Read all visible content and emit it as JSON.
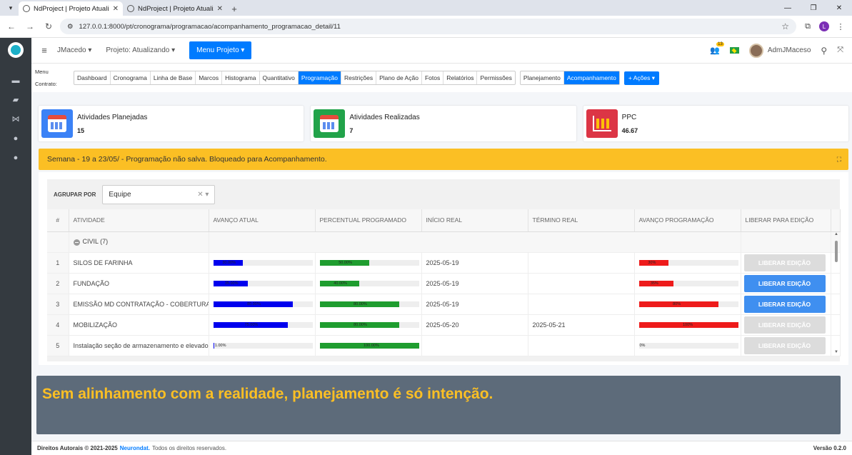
{
  "browser": {
    "tabs": [
      {
        "title": "NdProject | Projeto Atualizando",
        "active": true
      },
      {
        "title": "NdProject | Projeto Atualizando",
        "active": false
      }
    ],
    "url": "127.0.0.1:8000/pt/cronograma/programacao/acompanhamento_programacao_detail/11",
    "profile_initial": "L"
  },
  "topnav": {
    "user_menu": "JMacedo",
    "project_menu": "Projeto: Atualizando",
    "menu_projeto": "Menu Projeto",
    "notif_count": "13",
    "user_name": "AdmJMaceso"
  },
  "submenu": {
    "label_menu": "Menu",
    "label_contrato": "Contrato:",
    "items": [
      "Dashboard",
      "Cronograma",
      "Linha de Base",
      "Marcos",
      "Histograma",
      "Quantitativo",
      "Programação",
      "Restrições",
      "Plano de Ação",
      "Fotos",
      "Relatórios",
      "Permissões"
    ],
    "items2": [
      "Planejamento",
      "Acompanhamento"
    ],
    "acoes": "+ Ações"
  },
  "cards": [
    {
      "label": "Atividades Planejadas",
      "value": "15",
      "color": "#3b82f6"
    },
    {
      "label": "Atividades Realizadas",
      "value": "7",
      "color": "#22a34a"
    },
    {
      "label": "PPC",
      "value": "46.67",
      "color": "#dc3545"
    }
  ],
  "banner": {
    "text": "Semana - 19 a 23/05/ - Programação não salva. Bloqueado para Acompanhamento."
  },
  "group": {
    "label": "AGRUPAR POR",
    "value": "Equipe"
  },
  "table": {
    "headers": [
      "#",
      "ATIVIDADE",
      "AVANÇO ATUAL",
      "PERCENTUAL PROGRAMADO",
      "INÍCIO REAL",
      "TÉRMINO REAL",
      "AVANÇO PROGRAMAÇÃO",
      "LIBERAR PARA EDIÇÃO"
    ],
    "group_row": "CIVIL (7)",
    "rows": [
      {
        "num": "1",
        "atividade": "SILOS DE FARINHA",
        "atual": 30,
        "atual_label": "30.00%",
        "prog": 50,
        "prog_label": "50.00%",
        "inicio": "2025-05-19",
        "termino": "",
        "avanco": 30,
        "avanco_label": "30%",
        "btn": "LIBERAR EDIÇÃO",
        "btn_on": false
      },
      {
        "num": "2",
        "atividade": "FUNDAÇÃO",
        "atual": 35,
        "atual_label": "35.00%",
        "prog": 40,
        "prog_label": "40.00%",
        "inicio": "2025-05-19",
        "termino": "",
        "avanco": 35,
        "avanco_label": "35%",
        "btn": "LIBERAR EDIÇÃO",
        "btn_on": true
      },
      {
        "num": "3",
        "atividade": "EMISSÃO MD CONTRATAÇÃO - COBERTURA METÁLICA",
        "atual": 80,
        "atual_label": "80.00%",
        "prog": 80,
        "prog_label": "80.00%",
        "inicio": "2025-05-19",
        "termino": "",
        "avanco": 80,
        "avanco_label": "80%",
        "btn": "LIBERAR EDIÇÃO",
        "btn_on": true
      },
      {
        "num": "4",
        "atividade": "MOBILIZAÇÃO",
        "atual": 75,
        "atual_label": "75.00%",
        "prog": 80,
        "prog_label": "80.00%",
        "inicio": "2025-05-20",
        "termino": "2025-05-21",
        "avanco": 100,
        "avanco_label": "100%",
        "btn": "LIBERAR EDIÇÃO",
        "btn_on": false
      },
      {
        "num": "5",
        "atividade": "Instalação seção de armazenamento e elevador",
        "atual": 1,
        "atual_label": "1.00%",
        "prog": 100,
        "prog_label": "100.00%",
        "inicio": "",
        "termino": "",
        "avanco": 0,
        "avanco_label": "0%",
        "btn": "LIBERAR EDIÇÃO",
        "btn_on": false
      }
    ]
  },
  "overlay": {
    "text": "Sem alinhamento com a realidade, planejamento é só intenção."
  },
  "footer": {
    "copyright": "Direitos Autorais © 2021-2025",
    "brand": "Neurondat.",
    "rights": "Todos os direitos reservados.",
    "version": "Versão 0.2.0"
  },
  "colors": {
    "primary": "#007bff",
    "banner": "#fbbf24",
    "bar_blue": "#0000ee",
    "bar_green": "#1f9d2f",
    "bar_red": "#ee1b1b"
  }
}
